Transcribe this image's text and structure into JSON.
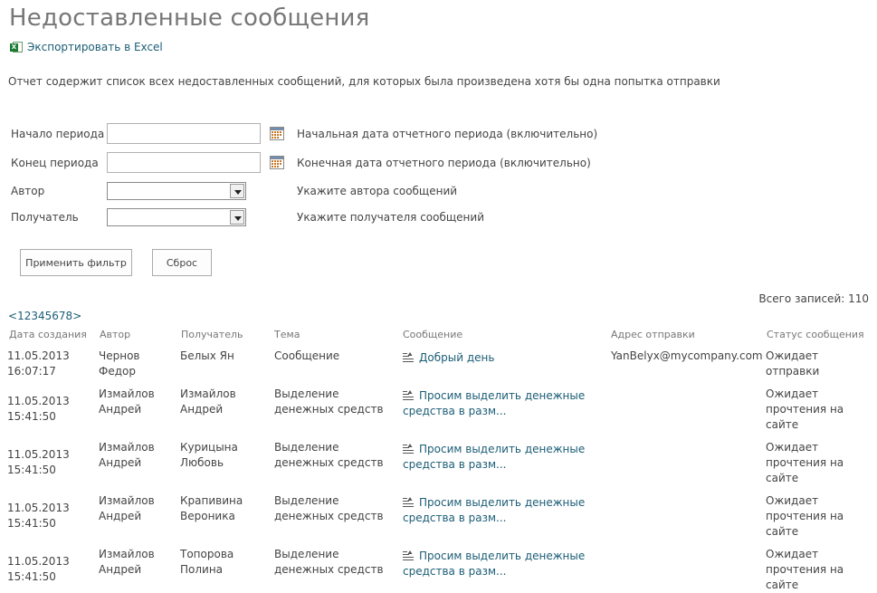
{
  "title": "Недоставленные сообщения",
  "export_label": "Экспортировать в Excel",
  "description": "Отчет содержит список всех недоставленных сообщений, для которых была произведена хотя бы одна попытка отправки",
  "filters": {
    "start_label": "Начало периода",
    "start_value": "",
    "start_hint": "Начальная дата отчетного периода (включительно)",
    "end_label": "Конец периода",
    "end_value": "",
    "end_hint": "Конечная дата отчетного периода (включительно)",
    "author_label": "Автор",
    "author_value": "",
    "author_hint": "Укажите автора сообщений",
    "recipient_label": "Получатель",
    "recipient_value": "",
    "recipient_hint": "Укажите получателя сообщений"
  },
  "buttons": {
    "apply": "Применить фильтр",
    "reset": "Сброс"
  },
  "total_label": "Всего записей: 110",
  "pager": {
    "prev": "<",
    "pages": [
      "1",
      "2",
      "3",
      "4",
      "5",
      "6",
      "7",
      "8"
    ],
    "next": ">"
  },
  "table": {
    "headers": {
      "date": "Дата создания",
      "author": "Автор",
      "recipient": "Получатель",
      "subject": "Тема",
      "message": "Сообщение",
      "address": "Адрес отправки",
      "status": "Статус сообщения"
    },
    "rows": [
      {
        "date": "11.05.2013 16:07:17",
        "author": "Чернов Федор",
        "recipient": "Белых Ян",
        "subject": "Сообщение",
        "message": "Добрый день",
        "address": "YanBelyx@mycompany.com",
        "status": "Ожидает отправки"
      },
      {
        "date": "11.05.2013 15:41:50",
        "author": "Измайлов Андрей",
        "recipient": "Измайлов Андрей",
        "subject": "Выделение денежных средств",
        "message": "Просим выделить денежные средства в разм...",
        "address": "",
        "status": "Ожидает прочтения на сайте"
      },
      {
        "date": "11.05.2013 15:41:50",
        "author": "Измайлов Андрей",
        "recipient": "Курицына Любовь",
        "subject": "Выделение денежных средств",
        "message": "Просим выделить денежные средства в разм...",
        "address": "",
        "status": "Ожидает прочтения на сайте"
      },
      {
        "date": "11.05.2013 15:41:50",
        "author": "Измайлов Андрей",
        "recipient": "Крапивина Вероника",
        "subject": "Выделение денежных средств",
        "message": "Просим выделить денежные средства в разм...",
        "address": "",
        "status": "Ожидает прочтения на сайте"
      },
      {
        "date": "11.05.2013 15:41:50",
        "author": "Измайлов Андрей",
        "recipient": "Топорова Полина",
        "subject": "Выделение денежных средств",
        "message": "Просим выделить денежные средства в разм...",
        "address": "",
        "status": "Ожидает прочтения на сайте"
      }
    ]
  }
}
